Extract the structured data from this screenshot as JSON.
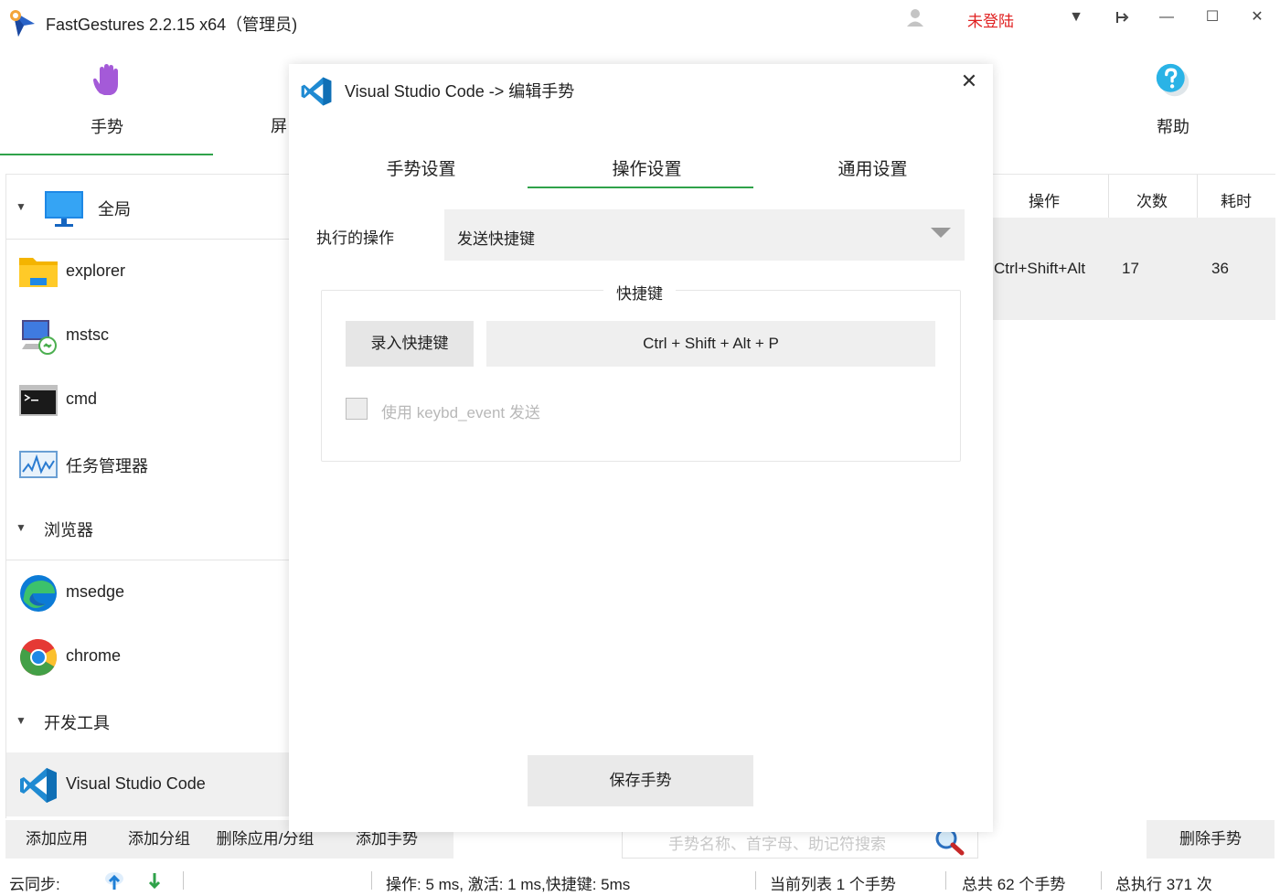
{
  "titlebar": {
    "title": "FastGestures 2.2.15 x64（管理员)",
    "login_status": "未登陆",
    "dropdown_glyph": "▼",
    "pin_glyph": "⇥",
    "minimize_glyph": "—",
    "maximize_glyph": "☐",
    "close_glyph": "✕",
    "login_color": "#e02020"
  },
  "top_tabs": {
    "gesture": "手势",
    "screen_partial": "屏",
    "help": "帮助"
  },
  "sidebar": {
    "items": [
      {
        "label": "全局",
        "type": "group",
        "icon": "monitor-icon"
      },
      {
        "label": "explorer",
        "type": "app",
        "icon": "folder-icon"
      },
      {
        "label": "mstsc",
        "type": "app",
        "icon": "remote-desktop-icon"
      },
      {
        "label": "cmd",
        "type": "app",
        "icon": "terminal-icon"
      },
      {
        "label": "任务管理器",
        "type": "app",
        "icon": "task-manager-icon"
      },
      {
        "label": "浏览器",
        "type": "group",
        "icon": ""
      },
      {
        "label": "msedge",
        "type": "app",
        "icon": "edge-icon"
      },
      {
        "label": "chrome",
        "type": "app",
        "icon": "chrome-icon"
      },
      {
        "label": "开发工具",
        "type": "group",
        "icon": ""
      },
      {
        "label": "Visual Studio Code",
        "type": "app",
        "icon": "vscode-icon",
        "selected": true
      }
    ]
  },
  "table": {
    "headers": {
      "action": "操作",
      "count": "次数",
      "time": "耗时"
    },
    "rows": [
      {
        "action": "Ctrl+Shift+Alt",
        "count": "17",
        "time": "36"
      }
    ]
  },
  "bottombar": {
    "add_app": "添加应用",
    "add_group": "添加分组",
    "delete_app": "删除应用/分组",
    "add_gesture": "添加手势",
    "search_placeholder": "手势名称、首字母、助记符搜索",
    "delete_gesture": "删除手势"
  },
  "statusbar": {
    "cloud_sync": "云同步:",
    "perf": "操作: 5 ms, 激活: 1 ms,快捷键: 5ms",
    "current_list": "当前列表 1 个手势",
    "total_gestures": "总共 62 个手势",
    "total_exec": "总执行 371 次"
  },
  "dialog": {
    "title": "Visual Studio Code -> 编辑手势",
    "close_glyph": "✕",
    "tabs": [
      "手势设置",
      "操作设置",
      "通用设置"
    ],
    "active_tab": "操作设置",
    "operation_label": "执行的操作",
    "operation_value": "发送快捷键",
    "hotkey_group_title": "快捷键",
    "record_button": "录入快捷键",
    "hotkey_value": "Ctrl + Shift + Alt + P",
    "keybd_event_label": "使用 keybd_event 发送",
    "keybd_event_checked": false,
    "save_button": "保存手势"
  },
  "colors": {
    "accent_green": "#2fa24a",
    "vscode_blue": "#1f8ad2",
    "selected_row_bg": "#f0f0f0",
    "button_bg": "#efefef"
  }
}
